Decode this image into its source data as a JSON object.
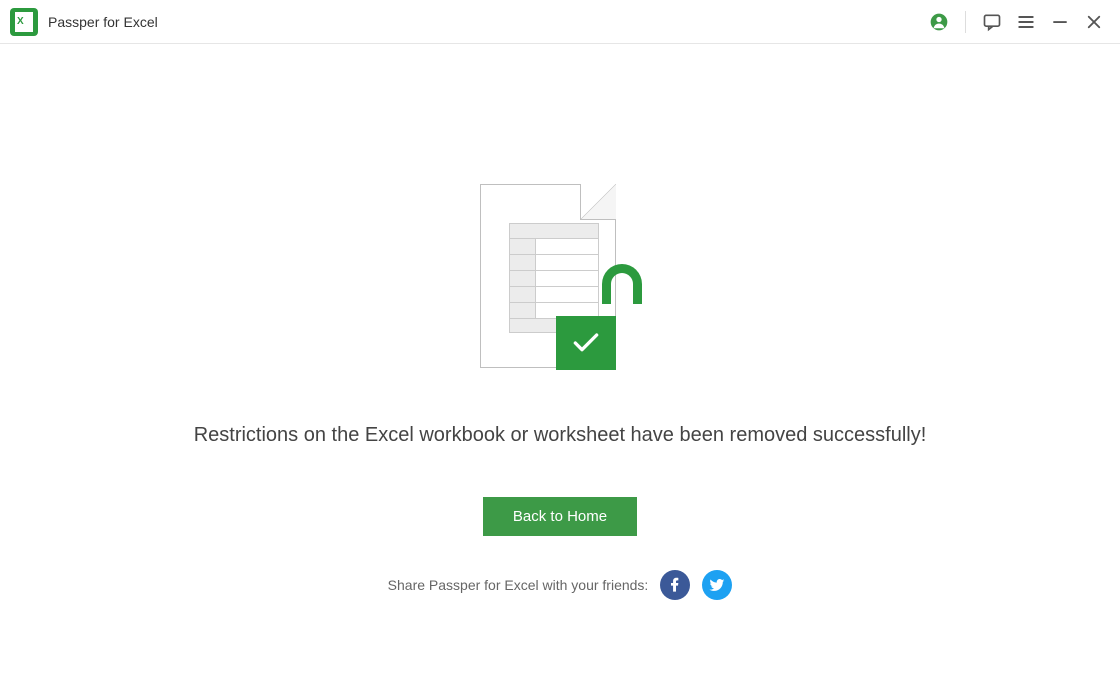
{
  "app": {
    "title": "Passper for Excel"
  },
  "main": {
    "success_message": "Restrictions on the Excel workbook or worksheet have been removed successfully!",
    "home_button_label": "Back to Home",
    "share_text": "Share Passper for Excel with your friends:"
  },
  "colors": {
    "brand": "#2c9a3e",
    "facebook": "#3b5998",
    "twitter": "#1da1f2"
  }
}
